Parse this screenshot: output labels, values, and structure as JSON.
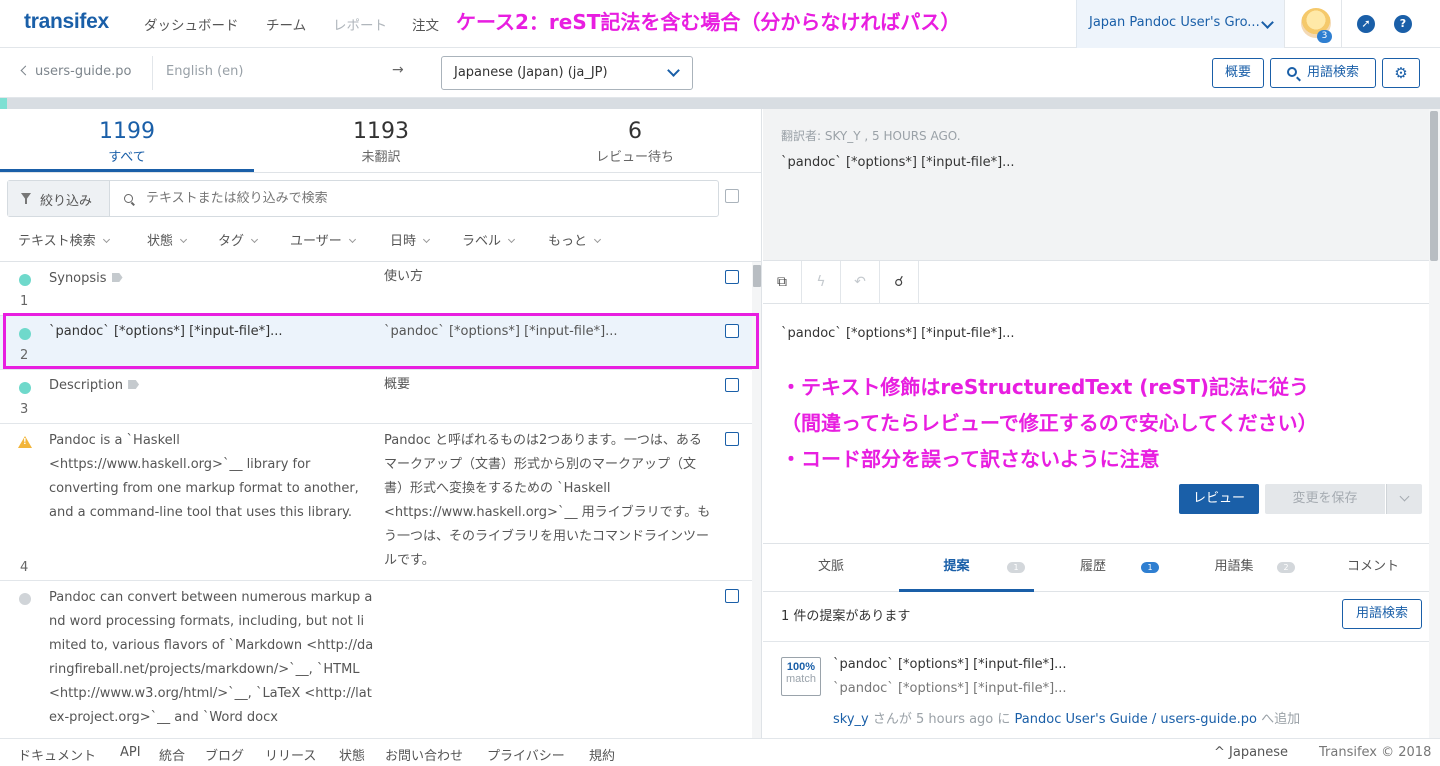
{
  "nav": {
    "logo": "transifex",
    "links": [
      "ダッシュボード",
      "チーム",
      "レポート",
      "注文"
    ],
    "headline": "ケース2：reST記法を含む場合（分からなければパス）",
    "org": "Japan Pandoc User's Gro...",
    "avatar_badge": "3",
    "icons": [
      "compass-icon",
      "help-icon"
    ]
  },
  "subbar": {
    "back": "users-guide.po",
    "source_lang": "English (en)",
    "arrow": "→",
    "target_lang": "Japanese (Japan) (ja_JP)",
    "overview_btn": "概要",
    "glossary_btn": "用語検索"
  },
  "progress": {
    "translated_fraction": 0.005
  },
  "stats": [
    {
      "num": "1199",
      "label": "すべて"
    },
    {
      "num": "1193",
      "label": "未翻訳"
    },
    {
      "num": "6",
      "label": "レビュー待ち"
    }
  ],
  "filter": {
    "button": "絞り込み",
    "placeholder": "テキストまたは絞り込みで検索",
    "facets": [
      "テキスト検索",
      "状態",
      "タグ",
      "ユーザー",
      "日時",
      "ラベル",
      "もっと"
    ]
  },
  "rows": [
    {
      "num": "1",
      "source": "Synopsis",
      "translation": "使い方",
      "status": "translated"
    },
    {
      "num": "2",
      "source": "`pandoc` [*options*] [*input-file*]...",
      "translation": "`pandoc` [*options*] [*input-file*]...",
      "status": "translated"
    },
    {
      "num": "3",
      "source": "Description",
      "translation": "概要",
      "status": "translated"
    },
    {
      "num": "4",
      "source": "Pandoc is a `Haskell <https://www.haskell.org>`__ library for converting from one markup format to another, and a command-line tool that uses this library.",
      "translation": "Pandoc と呼ばれるものは2つあります。一つは、あるマークアップ（文書）形式から別のマークアップ（文書）形式へ変換をするための `Haskell <https://www.haskell.org>`__ 用ライブラリです。もう一つは、そのライブラリを用いたコマンドラインツールです。",
      "status": "warning"
    },
    {
      "num": "",
      "source": "Pandoc can convert between numerous markup and word processing formats, including, but not limited to, various flavors of `Markdown <http://daringfireball.net/projects/markdown/>`__, `HTML <http://www.w3.org/html/>`__, `LaTeX <http://latex-project.org>`__ and `Word docx",
      "translation": "",
      "status": "untranslated"
    }
  ],
  "editor": {
    "history_meta": "翻訳者: SKY_Y , 5 HOURS AGO.",
    "history_text": "`pandoc` [*options*] [*input-file*]...",
    "source_text": "`pandoc` [*options*] [*input-file*]...",
    "note_lines": [
      "・テキスト修飾はreStructuredText (reST)記法に従う",
      "（間違ってたらレビューで修正するので安心してください）",
      "・コード部分を誤って訳さないように注意"
    ],
    "review_btn": "レビュー",
    "save_btn": "変更を保存"
  },
  "tabs": [
    {
      "label": "文脈",
      "badge": ""
    },
    {
      "label": "提案",
      "badge": "1"
    },
    {
      "label": "履歴",
      "badge": "1"
    },
    {
      "label": "用語集",
      "badge": "2"
    },
    {
      "label": "コメント",
      "badge": ""
    }
  ],
  "suggestions": {
    "count_text": "1 件の提案があります",
    "glossary_btn": "用語検索",
    "match_pct": "100%",
    "match_label": "match",
    "source": "`pandoc` [*options*] [*input-file*]...",
    "translation": "`pandoc` [*options*] [*input-file*]...",
    "user": "sky_y",
    "meta_mid": "さんが 5 hours ago に",
    "resource": "Pandoc User's Guide / users-guide.po",
    "meta_end": "へ追加"
  },
  "footer": {
    "links": [
      "ドキュメント",
      "API",
      "統合",
      "ブログ",
      "リリース",
      "状態",
      "お問い合わせ",
      "プライバシー",
      "規約"
    ],
    "language": "Japanese",
    "copyright": "Transifex © 2018"
  },
  "colors": {
    "accent": "#1a5fa8",
    "annotation": "#e81ee0",
    "translated": "#6fd9cb",
    "warning": "#f2b53a"
  }
}
